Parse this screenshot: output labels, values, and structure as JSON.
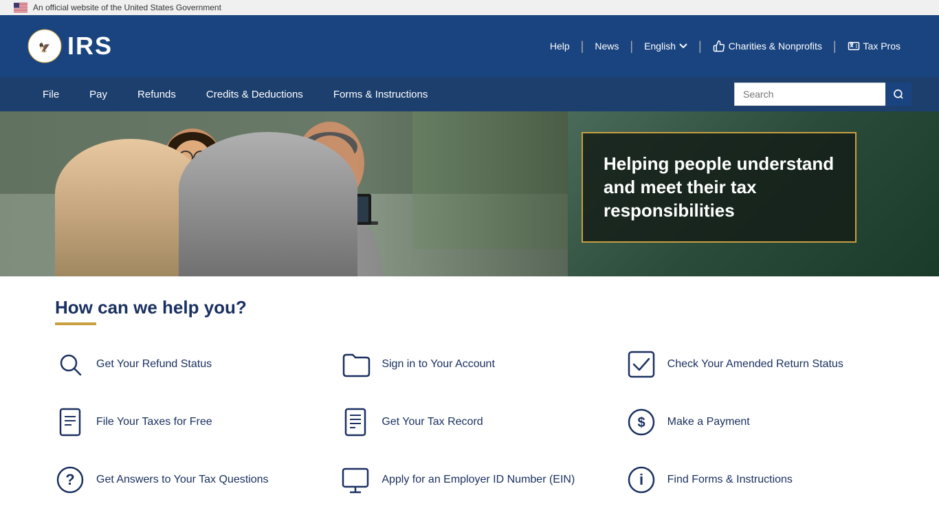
{
  "gov_banner": {
    "text": "An official website of the United States Government"
  },
  "header": {
    "logo_text": "IRS",
    "nav_links": [
      {
        "label": "Help",
        "id": "help"
      },
      {
        "label": "News",
        "id": "news"
      },
      {
        "label": "English",
        "id": "english",
        "has_dropdown": true
      },
      {
        "label": "Charities & Nonprofits",
        "id": "charities"
      },
      {
        "label": "Tax Pros",
        "id": "tax-pros"
      }
    ]
  },
  "main_nav": {
    "links": [
      {
        "label": "File",
        "id": "file"
      },
      {
        "label": "Pay",
        "id": "pay"
      },
      {
        "label": "Refunds",
        "id": "refunds"
      },
      {
        "label": "Credits & Deductions",
        "id": "credits"
      },
      {
        "label": "Forms & Instructions",
        "id": "forms"
      }
    ],
    "search_placeholder": "Search"
  },
  "hero": {
    "title": "Helping people understand and meet their tax responsibilities"
  },
  "help_section": {
    "title": "How can we help you?",
    "items": [
      {
        "id": "refund-status",
        "label": "Get Your Refund Status",
        "icon": "search"
      },
      {
        "id": "sign-in",
        "label": "Sign in to Your Account",
        "icon": "folder"
      },
      {
        "id": "amended-return",
        "label": "Check Your Amended Return Status",
        "icon": "checkbox"
      },
      {
        "id": "file-free",
        "label": "File Your Taxes for Free",
        "icon": "document"
      },
      {
        "id": "tax-record",
        "label": "Get Your Tax Record",
        "icon": "document2"
      },
      {
        "id": "make-payment",
        "label": "Make a Payment",
        "icon": "dollar"
      },
      {
        "id": "tax-questions",
        "label": "Get Answers to Your Tax Questions",
        "icon": "question"
      },
      {
        "id": "ein",
        "label": "Apply for an Employer ID Number (EIN)",
        "icon": "monitor"
      },
      {
        "id": "find-forms",
        "label": "Find Forms & Instructions",
        "icon": "info"
      }
    ]
  }
}
